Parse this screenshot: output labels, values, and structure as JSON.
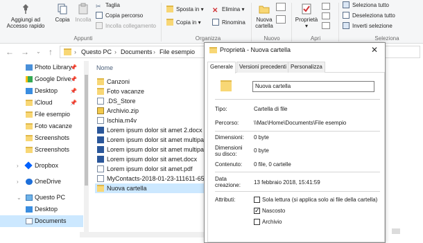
{
  "ribbon": {
    "clipboard": {
      "pin_label": "Aggiungi ad Accesso rapido",
      "copy_label": "Copia",
      "paste_label": "Incolla",
      "cut_label": "Taglia",
      "copy_path_label": "Copia percorso",
      "paste_shortcut_label": "Incolla collegamento",
      "group_label": "Appunti"
    },
    "organize": {
      "move_to_label": "Sposta in",
      "copy_to_label": "Copia in",
      "delete_label": "Elimina",
      "rename_label": "Rinomina",
      "group_label": "Organizza"
    },
    "new": {
      "new_folder_label": "Nuova cartella",
      "group_label": "Nuovo"
    },
    "open": {
      "properties_label": "Proprietà",
      "group_label": "Apri"
    },
    "select": {
      "select_all_label": "Seleziona tutto",
      "select_none_label": "Deseleziona tutto",
      "invert_label": "Inverti selezione",
      "group_label": "Seleziona"
    }
  },
  "address": {
    "crumbs": [
      "Questo PC",
      "Documents",
      "File esempio"
    ]
  },
  "sidebar": {
    "items": [
      {
        "label": "Photo Library",
        "pinned": true
      },
      {
        "label": "Google Drive",
        "pinned": true
      },
      {
        "label": "Desktop",
        "pinned": true
      },
      {
        "label": "iCloud",
        "pinned": true
      },
      {
        "label": "File esempio",
        "pinned": false
      },
      {
        "label": "Foto vacanze",
        "pinned": false
      },
      {
        "label": "Screenshots",
        "pinned": false
      },
      {
        "label": "Screenshots",
        "pinned": false
      },
      {
        "label": "Dropbox",
        "pinned": false
      },
      {
        "label": "OneDrive",
        "pinned": false
      },
      {
        "label": "Questo PC",
        "pinned": false
      },
      {
        "label": "Desktop",
        "pinned": false
      },
      {
        "label": "Documents",
        "pinned": false
      }
    ]
  },
  "filelist": {
    "column_name": "Nome",
    "files": [
      {
        "name": "Canzoni",
        "type": "folder"
      },
      {
        "name": "Foto vacanze",
        "type": "folder"
      },
      {
        "name": ".DS_Store",
        "type": "doc"
      },
      {
        "name": "Archivio.zip",
        "type": "zip"
      },
      {
        "name": "Ischia.m4v",
        "type": "video"
      },
      {
        "name": "Lorem ipsum dolor sit amet 2.docx",
        "type": "word"
      },
      {
        "name": "Lorem ipsum dolor sit amet multipag",
        "type": "word"
      },
      {
        "name": "Lorem ipsum dolor sit amet multipag",
        "type": "word"
      },
      {
        "name": "Lorem ipsum dolor sit amet.docx",
        "type": "word"
      },
      {
        "name": "Lorem ipsum dolor sit amet.pdf",
        "type": "pdf"
      },
      {
        "name": "MyContacts-2018-01-23-111611-656.",
        "type": "doc"
      },
      {
        "name": "Nuova cartella",
        "type": "folder"
      }
    ]
  },
  "dialog": {
    "title": "Proprietà - Nuova cartella",
    "tabs": [
      "Generale",
      "Versioni precedenti",
      "Personalizza"
    ],
    "name_value": "Nuova cartella",
    "type_label": "Tipo:",
    "type_value": "Cartella di file",
    "path_label": "Percorso:",
    "path_value": "\\\\Mac\\Home\\Documents\\File esempio",
    "size_label": "Dimensioni:",
    "size_value": "0 byte",
    "disk_size_label_1": "Dimensioni",
    "disk_size_label_2": "su disco:",
    "disk_size_value": "0 byte",
    "contents_label": "Contenuto:",
    "contents_value": "0 file, 0 cartelle",
    "created_label_1": "Data",
    "created_label_2": "creazione:",
    "created_value": "13 febbraio 2018, 15:41:59",
    "attributes_label": "Attributi:",
    "readonly_label": "Sola lettura (si applica solo ai file della cartella)",
    "readonly_checked": false,
    "hidden_label": "Nascosto",
    "hidden_checked": true,
    "archive_label": "Archivio",
    "archive_checked": false
  },
  "colors": {
    "selection": "#cce8ff",
    "folder": "#f8d775",
    "word_blue": "#2b579a",
    "delete_red": "#d13438"
  }
}
